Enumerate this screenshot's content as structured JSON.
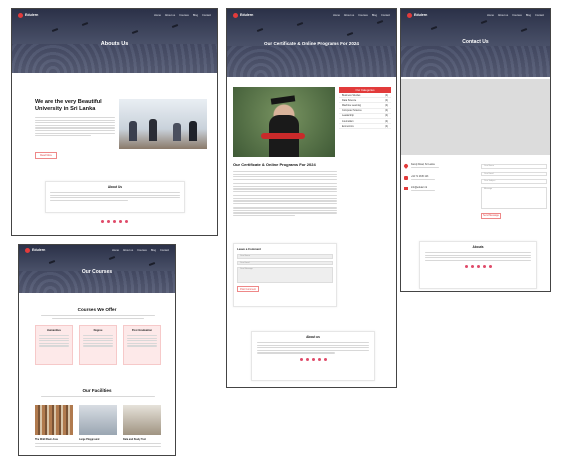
{
  "brand": {
    "name": "Edulern",
    "accent": "#e23b3b",
    "nav_dark": "#2b3148"
  },
  "nav": {
    "items": [
      "Home",
      "About us",
      "Courses",
      "Blog",
      "Contact"
    ]
  },
  "about_page": {
    "hero_title": "Abouts Us",
    "heading": "We are the very Beautiful University in Sri Lanka",
    "read_more": "Read More",
    "about_card_title": "About Us"
  },
  "courses_page": {
    "hero_title": "Our Courses",
    "courses_heading": "Courses We Offer",
    "course_cards": [
      "Humanities",
      "Degree",
      "Post Graduation"
    ],
    "facilities_heading": "Our Facilities",
    "facilities": [
      "The Wild Rlazn Area",
      "Large Playground",
      "Data and Study Tool"
    ]
  },
  "certificate_page": {
    "hero_title": "Our Certificate & Online Programs For 2024",
    "categories_title": "Our Categories",
    "categories": [
      {
        "name": "Business Studies",
        "count": "(4)"
      },
      {
        "name": "Data Science",
        "count": "(4)"
      },
      {
        "name": "Machine Learning",
        "count": "(4)"
      },
      {
        "name": "Computer Science",
        "count": "(4)"
      },
      {
        "name": "Leadership",
        "count": "(4)"
      },
      {
        "name": "Journalism",
        "count": "(4)"
      },
      {
        "name": "Economics",
        "count": "(4)"
      }
    ],
    "section_title": "Our Certificate & Online Programs For 2024",
    "form_title": "Leave a Comment",
    "form_fields": [
      "Your Name",
      "Your Email",
      "Your Message"
    ],
    "form_button": "Post Comment",
    "about_title": "About us"
  },
  "contact_page": {
    "hero_title": "Contact Us",
    "contact_items": [
      {
        "icon": "location-icon",
        "text": "Kandy Road, Sri Lanka"
      },
      {
        "icon": "phone-icon",
        "text": "+94 71 2345 123"
      },
      {
        "icon": "mail-icon",
        "text": "info@edulern.lk"
      }
    ],
    "form_fields": [
      "Your Name",
      "Your Email",
      "Your Subject",
      "Message"
    ],
    "form_button": "Send Message",
    "about_title": "Abouts"
  }
}
